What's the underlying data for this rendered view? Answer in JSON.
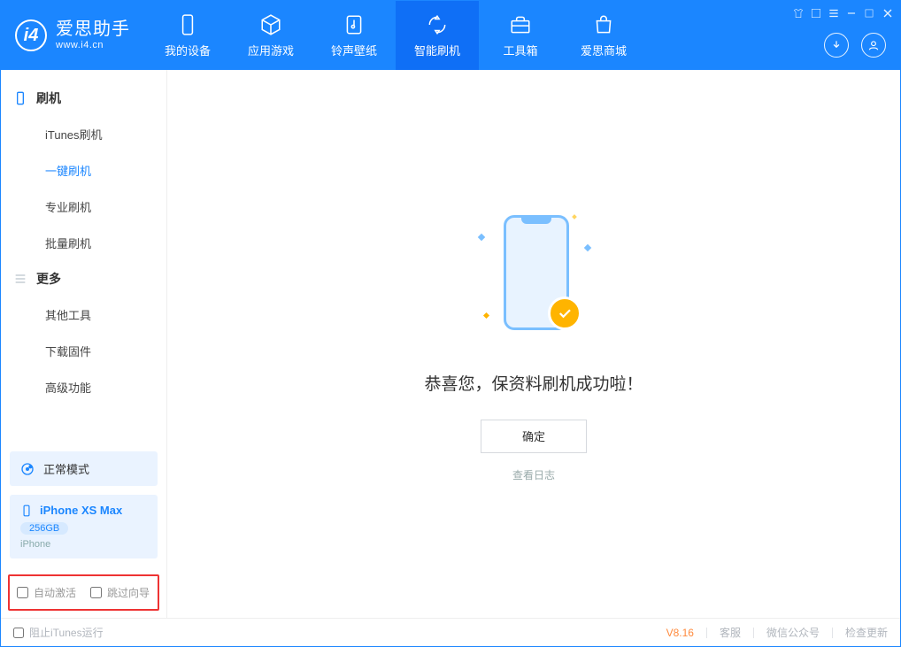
{
  "app": {
    "name": "爱思助手",
    "url": "www.i4.cn"
  },
  "topnav": [
    {
      "label": "我的设备",
      "icon": "device"
    },
    {
      "label": "应用游戏",
      "icon": "cube"
    },
    {
      "label": "铃声壁纸",
      "icon": "music"
    },
    {
      "label": "智能刷机",
      "icon": "refresh",
      "active": true
    },
    {
      "label": "工具箱",
      "icon": "toolbox"
    },
    {
      "label": "爱思商城",
      "icon": "bag"
    }
  ],
  "sidebar": {
    "cats": [
      {
        "title": "刷机",
        "items": [
          "iTunes刷机",
          "一键刷机",
          "专业刷机",
          "批量刷机"
        ],
        "activeIndex": 1
      },
      {
        "title": "更多",
        "items": [
          "其他工具",
          "下载固件",
          "高级功能"
        ]
      }
    ],
    "mode": "正常模式",
    "device": {
      "name": "iPhone XS Max",
      "storage": "256GB",
      "type": "iPhone"
    },
    "checks": {
      "autoActivate": "自动激活",
      "skipGuide": "跳过向导"
    }
  },
  "main": {
    "successTitle": "恭喜您，保资料刷机成功啦！",
    "okButton": "确定",
    "viewLog": "查看日志"
  },
  "status": {
    "blockItunes": "阻止iTunes运行",
    "version": "V8.16",
    "links": [
      "客服",
      "微信公众号",
      "检查更新"
    ]
  }
}
